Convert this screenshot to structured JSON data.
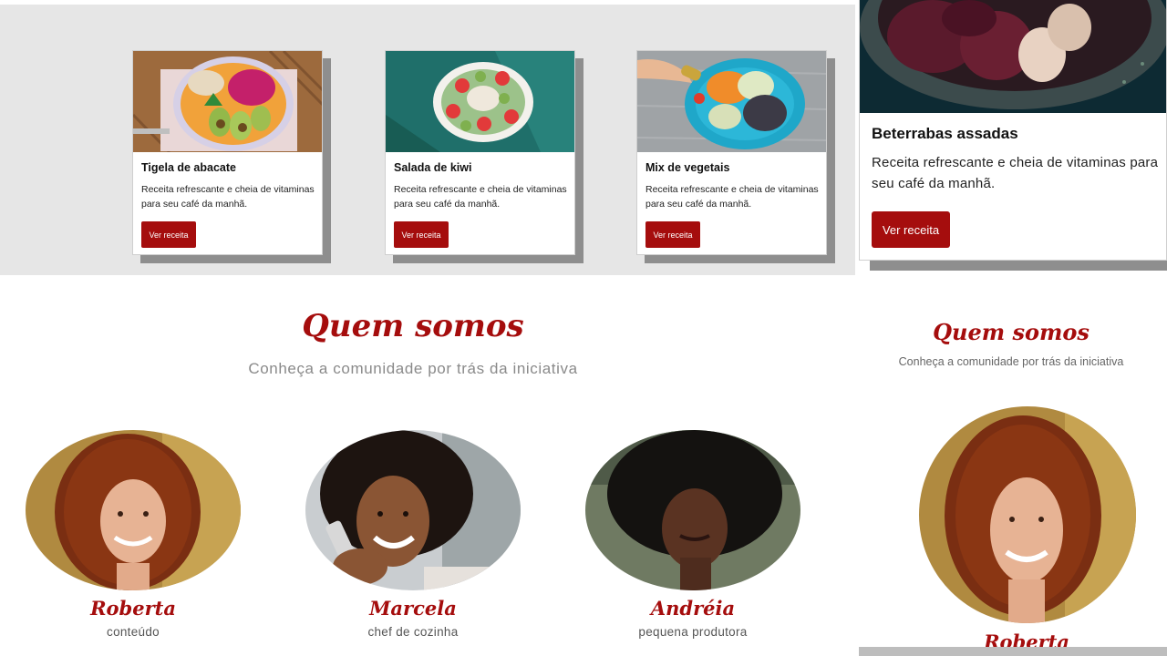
{
  "recipes": [
    {
      "title": "Tigela de abacate",
      "desc": "Receita refrescante e cheia de vitaminas para seu café da manhã.",
      "button": "Ver receita"
    },
    {
      "title": "Salada de kiwi",
      "desc": "Receita refrescante e cheia de vitaminas para seu café da manhã.",
      "button": "Ver receita"
    },
    {
      "title": "Mix de vegetais",
      "desc": "Receita refrescante e cheia de vitaminas para seu café da manhã.",
      "button": "Ver receita"
    }
  ],
  "mobile_recipe": {
    "title": "Beterrabas assadas",
    "desc": "Receita refrescante e cheia de vitaminas para seu café da manhã.",
    "button": "Ver receita"
  },
  "about": {
    "title": "Quem somos",
    "subtitle": "Conheça a comunidade por trás da iniciativa",
    "people": [
      {
        "name": "Roberta",
        "role": "conteúdo"
      },
      {
        "name": "Marcela",
        "role": "chef de cozinha"
      },
      {
        "name": "Andréia",
        "role": "pequena produtora"
      }
    ]
  },
  "mobile_about": {
    "title": "Quem somos",
    "subtitle": "Conheça a comunidade por trás da iniciativa",
    "person_name": "Roberta"
  },
  "colors": {
    "accent": "#a50d0d",
    "panel_bg": "#e6e6e6",
    "shadow": "#8e8e8e"
  }
}
